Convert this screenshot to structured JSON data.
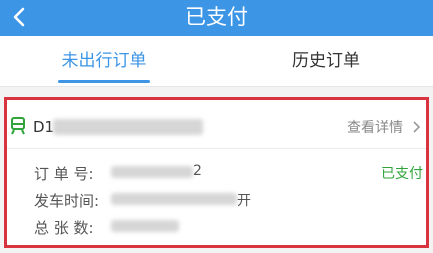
{
  "header": {
    "title": "已支付"
  },
  "tabs": [
    {
      "label": "未出行订单",
      "active": true
    },
    {
      "label": "历史订单",
      "active": false
    }
  ],
  "order": {
    "train_prefix": "D1",
    "detail_link": "查看详情",
    "status": "已支付",
    "order_no_label": "订 单 号:",
    "order_no_suffix": "2",
    "depart_label": "发车时间:",
    "depart_suffix": "开",
    "count_label": "总 张 数:"
  },
  "colors": {
    "accent": "#3d95e6",
    "status": "#2fa43a",
    "highlight_border": "#d9333f"
  }
}
